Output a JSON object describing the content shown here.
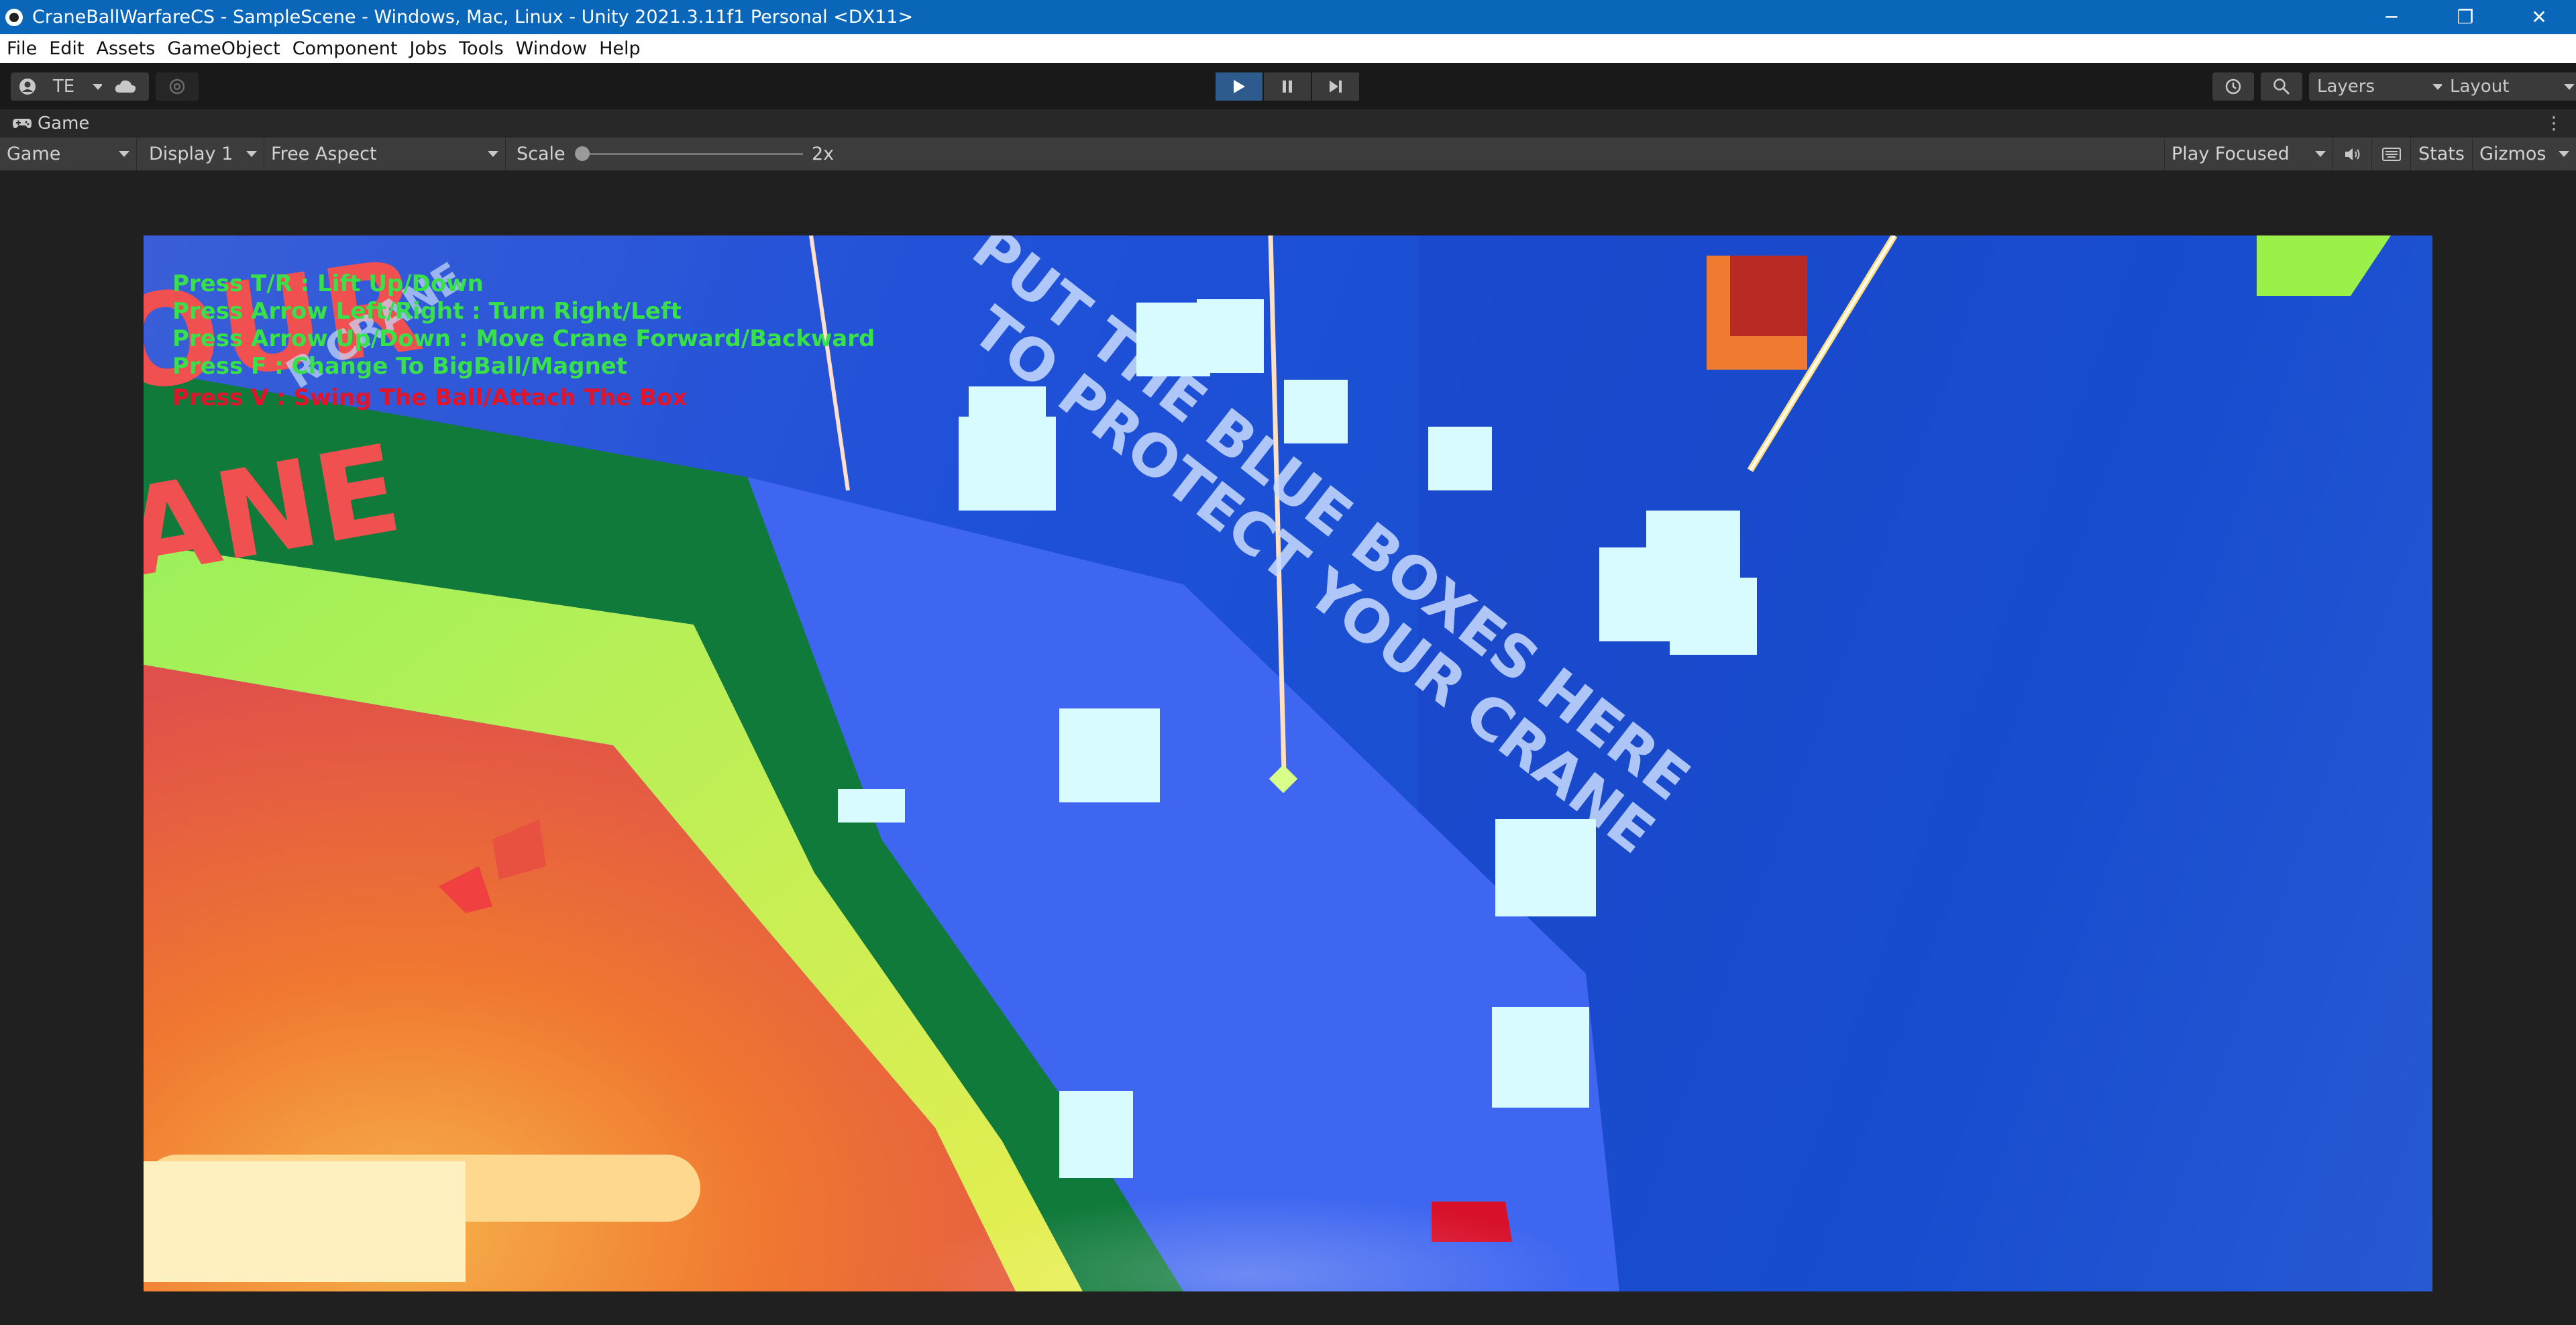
{
  "window": {
    "title": "CraneBallWarfareCS - SampleScene - Windows, Mac, Linux - Unity 2021.3.11f1 Personal <DX11>",
    "minimize": "─",
    "restore": "❐",
    "close": "✕"
  },
  "menu": [
    "File",
    "Edit",
    "Assets",
    "GameObject",
    "Component",
    "Jobs",
    "Tools",
    "Window",
    "Help"
  ],
  "toolbar": {
    "account": "TE",
    "layers": "Layers",
    "layout": "Layout"
  },
  "tab": {
    "label": "Game"
  },
  "gamebar": {
    "view": "Game",
    "display": "Display 1",
    "aspect": "Free Aspect",
    "scale_label": "Scale",
    "scale_value": "2x",
    "play_mode": "Play Focused",
    "stats": "Stats",
    "gizmos": "Gizmos"
  },
  "hud": {
    "lines": [
      "Press T/R : Lift Up/Down",
      "Press Arrow Left/Right : Turn Right/Left",
      "Press Arrow Up/Down : Move Crane Forward/Backward",
      "Press F : Change To BigBall/Magnet",
      "Press V : Swing The Ball/Attach The Box"
    ],
    "colors": [
      "#38e04a",
      "#38e04a",
      "#38e04a",
      "#38e04a",
      "#e0152c"
    ]
  },
  "scene_text": {
    "floor_line1": "PUT THE BLUE BOXES HERE",
    "floor_line2": "TO PROTECT YOUR CRANE",
    "big_word_1": "OUR",
    "big_word_2": "ANE",
    "small_word": "R CRANE"
  },
  "colors": {
    "titlebar": "#0a66b8",
    "accent_play": "#2d5b8e",
    "floor_blue": "#1e50d8",
    "ring_green": "#0f7a3a",
    "ring_lime": "#b4f04a",
    "inner_orange": "#f07830",
    "box_cyan": "#d8fbff"
  }
}
